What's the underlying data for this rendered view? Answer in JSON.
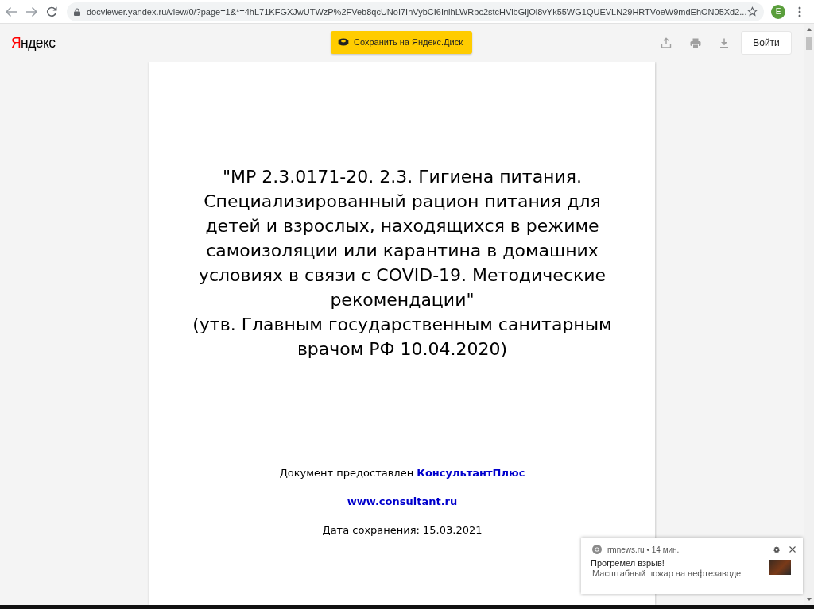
{
  "browser": {
    "url": "docviewer.yandex.ru/view/0/?page=1&*=4hL71KFGXJwUTWzP%2FVeb8qcUNoI7InVybCI6InlhLWRpc2stcHVibGljOi8vYk55WG1QUEVLN29HRTVoeW9mdEhON05Xd2...",
    "profile_initial": "E"
  },
  "header": {
    "logo": "Яндекс",
    "save_button": "Сохранить на Яндекс.Диск",
    "login_button": "Войти"
  },
  "document": {
    "title": "\"МР 2.3.0171-20. 2.3. Гигиена питания.\nСпециализированный рацион питания для\nдетей и взрослых, находящихся в режиме\nсамоизоляции или карантина в домашних\nусловиях в связи с COVID-19. Методические\nрекомендации\"",
    "approval": "(утв. Главным государственным санитарным\nврачом РФ 10.04.2020)",
    "provided_by": "Документ предоставлен **КонсультантПлюс**",
    "website": "www.consultant.ru",
    "saved_date": "Дата сохранения: 15.03.2021"
  },
  "notification": {
    "meta": "rmnews.ru • 14 мин.",
    "title": "Прогремел взрыв!",
    "body": "Масштабный пожар на нефтезаводе"
  }
}
